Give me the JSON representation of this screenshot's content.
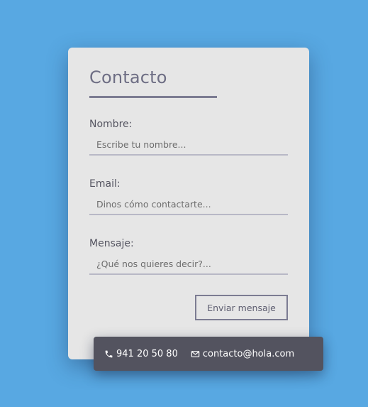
{
  "form": {
    "title": "Contacto",
    "fields": [
      {
        "label": "Nombre:",
        "placeholder": "Escribe tu nombre..."
      },
      {
        "label": "Email:",
        "placeholder": "Dinos cómo contactarte..."
      },
      {
        "label": "Mensaje:",
        "placeholder": "¿Qué nos quieres decir?..."
      }
    ],
    "submit_label": "Enviar mensaje"
  },
  "contact_bar": {
    "phone": "941 20 50 80",
    "phone_icon": "phone-icon",
    "email": "contacto@hola.com",
    "email_icon": "envelope-icon"
  },
  "colors": {
    "background": "#58a8e2",
    "card": "#e6e6e6",
    "accent": "#7c7c92",
    "info_bar": "#53535f"
  }
}
